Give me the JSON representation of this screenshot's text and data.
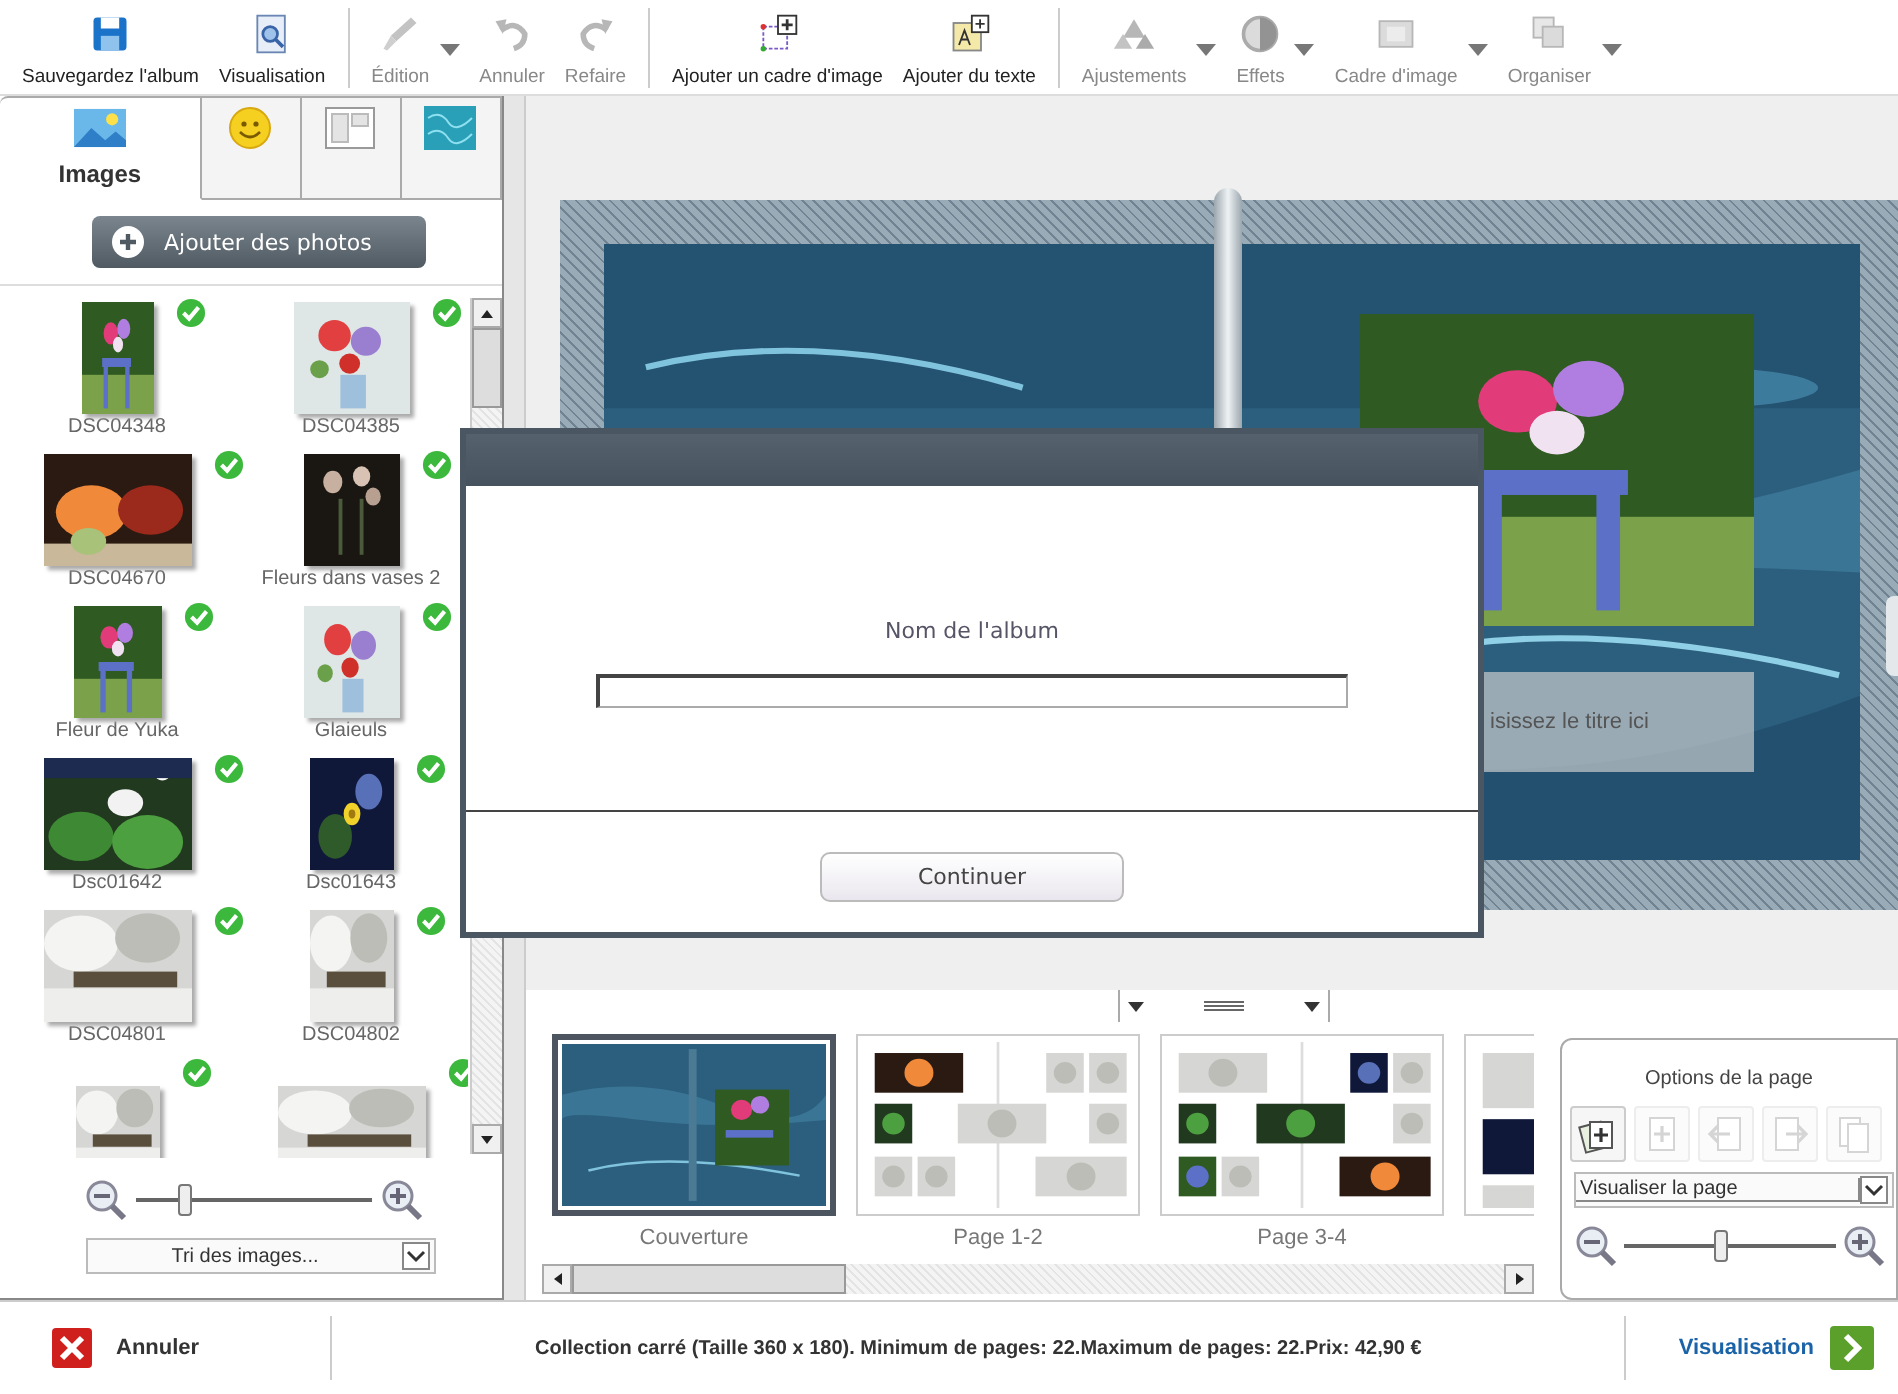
{
  "toolbar_groups": [
    {
      "tools": [
        {
          "label": "Sauvegardez l'album",
          "disabled": false,
          "caret": false
        },
        {
          "label": "Visualisation",
          "disabled": false,
          "caret": false
        }
      ]
    },
    {
      "tools": [
        {
          "label": "Édition",
          "disabled": true,
          "caret": true
        },
        {
          "label": "Annuler",
          "disabled": true,
          "caret": false
        },
        {
          "label": "Refaire",
          "disabled": true,
          "caret": false
        }
      ]
    },
    {
      "tools": [
        {
          "label": "Ajouter un cadre d'image",
          "disabled": false,
          "caret": false
        },
        {
          "label": "Ajouter du texte",
          "disabled": false,
          "caret": false
        }
      ]
    },
    {
      "tools": [
        {
          "label": "Ajustements",
          "disabled": true,
          "caret": true
        },
        {
          "label": "Effets",
          "disabled": true,
          "caret": true
        },
        {
          "label": "Cadre d'image",
          "disabled": true,
          "caret": true
        },
        {
          "label": "Organiser",
          "disabled": true,
          "caret": true
        }
      ]
    }
  ],
  "sidebar": {
    "tabs": [
      {
        "label": "Images",
        "selected": true
      },
      {
        "selected": false
      },
      {
        "selected": false
      },
      {
        "selected": false
      }
    ],
    "add_button": "Ajouter des photos",
    "photos": [
      {
        "label": "DSC04348",
        "checked": true
      },
      {
        "label": "DSC04385",
        "checked": true
      },
      {
        "label": "DSC04670",
        "checked": true
      },
      {
        "label": "Fleurs dans vases 2",
        "checked": true
      },
      {
        "label": "Fleur de Yuka",
        "checked": true
      },
      {
        "label": "Glaieuls",
        "checked": true
      },
      {
        "label": "Dsc01642",
        "checked": true
      },
      {
        "label": "Dsc01643",
        "checked": true
      },
      {
        "label": "DSC04801",
        "checked": true
      },
      {
        "label": "DSC04802",
        "checked": true
      },
      {
        "checked": true
      },
      {
        "checked": true
      }
    ],
    "zoom": {
      "level": 0.2
    },
    "sort": {
      "value": "Tri des images..."
    }
  },
  "canvas": {
    "title_placeholder": "isissez le titre ici"
  },
  "dialog": {
    "label": "Nom de l'album",
    "button": "Continuer"
  },
  "filmstrip": {
    "pages": [
      {
        "label": "Couverture",
        "selected": true
      },
      {
        "label": "Page 1-2",
        "selected": false
      },
      {
        "label": "Page 3-4",
        "selected": false
      },
      {
        "selected": false
      }
    ]
  },
  "page_options": {
    "title": "Options de la page",
    "buttons": [
      {
        "disabled": false
      },
      {
        "disabled": true
      },
      {
        "disabled": true
      },
      {
        "disabled": true
      },
      {
        "disabled": true
      }
    ],
    "view": "Visualiser la page",
    "zoom": {
      "level": 0.45
    }
  },
  "status_bar": {
    "cancel": "Annuler",
    "info": "Collection carré (Taille 360 x 180). Minimum de pages: 22.Maximum de pages: 22.Prix: 42,90 €",
    "preview": "Visualisation"
  }
}
